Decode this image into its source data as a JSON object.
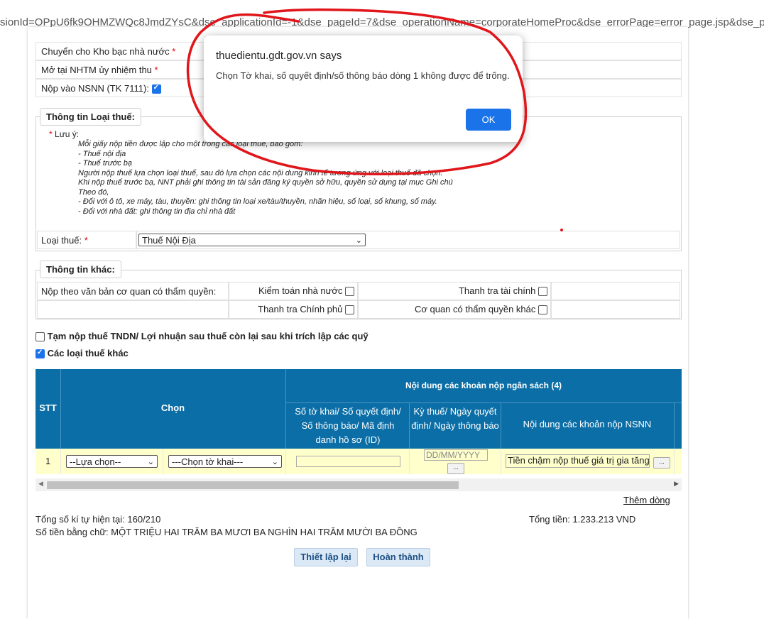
{
  "browser": {
    "url_fragment": "sionId=OPpU6fk9OHMZWQc8JmdZYsC&dse_applicationId=-1&dse_pageId=7&dse_operationName=corporateHomeProc&dse_errorPage=error_page.jsp&dse_processorState"
  },
  "top_rows": {
    "kho_bac_label": "Chuyển cho Kho bạc nhà nước",
    "nhtm_label": "Mở tại NHTM ủy nhiệm thu",
    "nsnn_label": "Nộp vào NSNN (TK 7111):",
    "required_mark": "*",
    "nsnn_checked": true
  },
  "tax_type_section": {
    "legend": "Thông tin Loại thuế:",
    "note_title": "Lưu ý:",
    "note_lines": [
      "Mỗi giấy nộp tiền được lập cho một trong các loại thuế, bao gồm:",
      "- Thuế nội địa",
      "- Thuế trước bạ",
      "Người nộp thuế lựa chọn loại thuế, sau đó lựa chọn các nội dung kinh tế tương ứng với loại thuế đã chọn.",
      "Khi nộp thuế trước bạ, NNT phải ghi thông tin tài sản đăng ký quyền sở hữu, quyền sử dụng tại mục Ghi chú",
      "Theo đó,",
      "- Đối với ô tô, xe máy, tàu, thuyền: ghi thông tin loại xe/tàu/thuyền, nhãn hiệu, số loại, số khung, số máy.",
      "- Đối với nhà đất: ghi thông tin địa chỉ nhà đất"
    ],
    "tax_type_label": "Loại thuế:",
    "tax_type_value": "Thuế Nội Địa"
  },
  "other_info": {
    "legend": "Thông tin khác:",
    "authority_label": "Nộp theo văn bản cơ quan có thẩm quyền:",
    "options": {
      "kiem_toan": "Kiểm toán nhà nước",
      "thanh_tra_tc": "Thanh tra tài chính",
      "thanh_tra_cp": "Thanh tra Chính phủ",
      "co_quan_khac": "Cơ quan có thẩm quyền khác"
    }
  },
  "checks": {
    "tam_nop_label": "Tạm nộp thuế TNDN/ Lợi nhuận sau thuế còn lại sau khi trích lập các quỹ",
    "tam_nop_checked": false,
    "cac_loai_label": "Các loại thuế khác",
    "cac_loai_checked": true
  },
  "grid": {
    "col_stt": "STT",
    "col_chon": "Chọn",
    "group_header": "Nội dung các khoản nộp ngân sách (4)",
    "col_so_to_khai": "Số tờ khai/ Số quyết định/ Số thông báo/ Mã định danh hồ sơ (ID)",
    "col_ky_thue": "Kỳ thuế/ Ngày quyết định/ Ngày thông báo",
    "col_noi_dung": "Nội dung các khoản nộp NSNN",
    "row_stt": "1",
    "select_lua_chon": "--Lựa chọn--",
    "select_to_khai": "---Chọn tờ khai---",
    "date_placeholder": "DD/MM/YYYY",
    "noi_dung_value": "Tiền chậm nộp thuế giá trị gia tăng",
    "dots": "..."
  },
  "footer": {
    "them_dong": "Thêm dòng",
    "tong_ky_tu": "Tổng số kí tự hiện tại: 160/210",
    "tong_tien": "Tổng tiền: 1.233.213 VND",
    "bang_chu": "Số tiền bằng chữ: MỘT TRIỆU HAI TRĂM BA MƯƠI BA NGHÌN HAI TRĂM MƯỜI BA ĐỒNG",
    "btn_reset": "Thiết lập lại",
    "btn_done": "Hoàn thành"
  },
  "dialog": {
    "title": "thuedientu.gdt.gov.vn says",
    "message": "Chọn Tờ khai, số quyết định/số thông báo dòng 1 không được để trống.",
    "ok_label": "OK"
  },
  "colors": {
    "grid_header": "#0b6ea6",
    "row_highlight": "#ffffcc",
    "annotation": "#e0161b",
    "ok_button": "#1a73e8"
  }
}
